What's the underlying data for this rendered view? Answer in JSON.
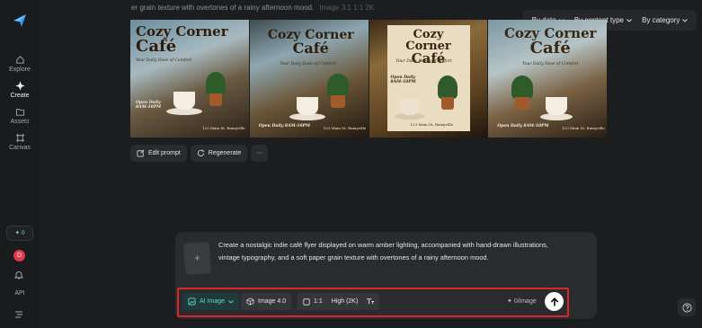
{
  "sidebar": {
    "items": [
      {
        "label": "Explore",
        "icon": "home-icon"
      },
      {
        "label": "Create",
        "icon": "sparkle-icon"
      },
      {
        "label": "Assets",
        "icon": "folder-icon"
      },
      {
        "label": "Canvas",
        "icon": "canvas-icon"
      }
    ],
    "credits": "✦ 0",
    "avatar_initial": "D",
    "api_label": "API"
  },
  "header": {
    "prompt_snippet": "er grain texture with overtones of a rainy afternoon mood.",
    "meta": "Image 3.1   1:1   2K"
  },
  "filters": [
    {
      "label": "By date"
    },
    {
      "label": "By content type"
    },
    {
      "label": "By category"
    }
  ],
  "posters": [
    {
      "title_line1": "Cozy Corner",
      "title_line2": "Café",
      "subtitle": "Your Daily Dose of Comfort",
      "hours_line1": "Open Daily",
      "hours_line2": "8AM-10PM",
      "address": "123 Main St, Rainyville"
    },
    {
      "title_line1": "Cozy Corner",
      "title_line2": "Café",
      "subtitle": "Your Daily Dose of Comfort",
      "hours_line1": "Open Daily 8AM-10PM",
      "hours_line2": "",
      "address": "123 Main St, Rainyville"
    },
    {
      "title_line1": "Cozy Corner",
      "title_line2": "Café",
      "subtitle": "Your Daily Dose of Comfort",
      "hours_line1": "Open Daily",
      "hours_line2": "8AM-10PM",
      "address": "123 Main St, Rainyville"
    },
    {
      "title_line1": "Cozy Corner",
      "title_line2": "Café",
      "subtitle": "Your Daily Dose of Comfort",
      "hours_line1": "Open Daily 8AM-10PM",
      "hours_line2": "",
      "address": "123 Main St, Rainyville"
    }
  ],
  "actions": {
    "edit_prompt": "Edit prompt",
    "regenerate": "Regenerate",
    "more": "···"
  },
  "composer": {
    "upload_glyph": "+",
    "prompt": "Create a nostalgic indie café flyer displayed on warm amber lighting, accompanied with hand-drawn illustrations, vintage typography, and a soft paper grain texture with overtones of a rainy afternoon mood.",
    "mode": "AI Image",
    "model": "Image 4.0",
    "ratio": "1:1",
    "quality": "High (2K)",
    "cost": "0/image"
  },
  "colors": {
    "background": "#1c1d1f",
    "accent_teal": "#63d6c3",
    "highlight_red": "#d9252b"
  }
}
